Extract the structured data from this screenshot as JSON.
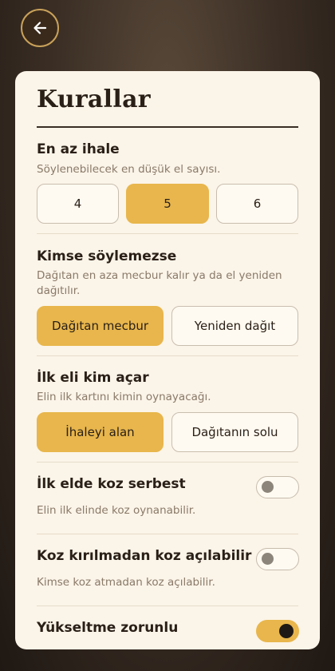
{
  "back_button": {
    "icon": "arrow-left-icon"
  },
  "card": {
    "title": "Kurallar",
    "min_bid": {
      "heading": "En az ihale",
      "description": "Söylenebilecek en düşük el sayısı.",
      "options": [
        {
          "label": "4",
          "selected": false
        },
        {
          "label": "5",
          "selected": true
        },
        {
          "label": "6",
          "selected": false
        }
      ]
    },
    "nobody_bids": {
      "heading": "Kimse söylemezse",
      "description": "Dağıtan en aza mecbur kalır ya da el yeniden dağıtılır.",
      "options": [
        {
          "label": "Dağıtan mecbur",
          "selected": true
        },
        {
          "label": "Yeniden dağıt",
          "selected": false
        }
      ]
    },
    "first_lead": {
      "heading": "İlk eli kim açar",
      "description": "Elin ilk kartını kimin oynayacağı.",
      "options": [
        {
          "label": "İhaleyi alan",
          "selected": true
        },
        {
          "label": "Dağıtanın solu",
          "selected": false
        }
      ]
    },
    "trump_first_trick": {
      "heading": "İlk elde koz serbest",
      "description": "Elin ilk elinde koz oynanabilir.",
      "enabled": false
    },
    "trump_unbroken": {
      "heading": "Koz kırılmadan koz açılabilir",
      "description": "Kimse koz atmadan koz açılabilir.",
      "enabled": false
    },
    "must_overtake": {
      "heading": "Yükseltme zorunlu",
      "enabled": true
    }
  },
  "colors": {
    "accent": "#e8b64c",
    "card": "#fbf4e8",
    "text": "#2a2018",
    "muted": "#8a7a69"
  }
}
